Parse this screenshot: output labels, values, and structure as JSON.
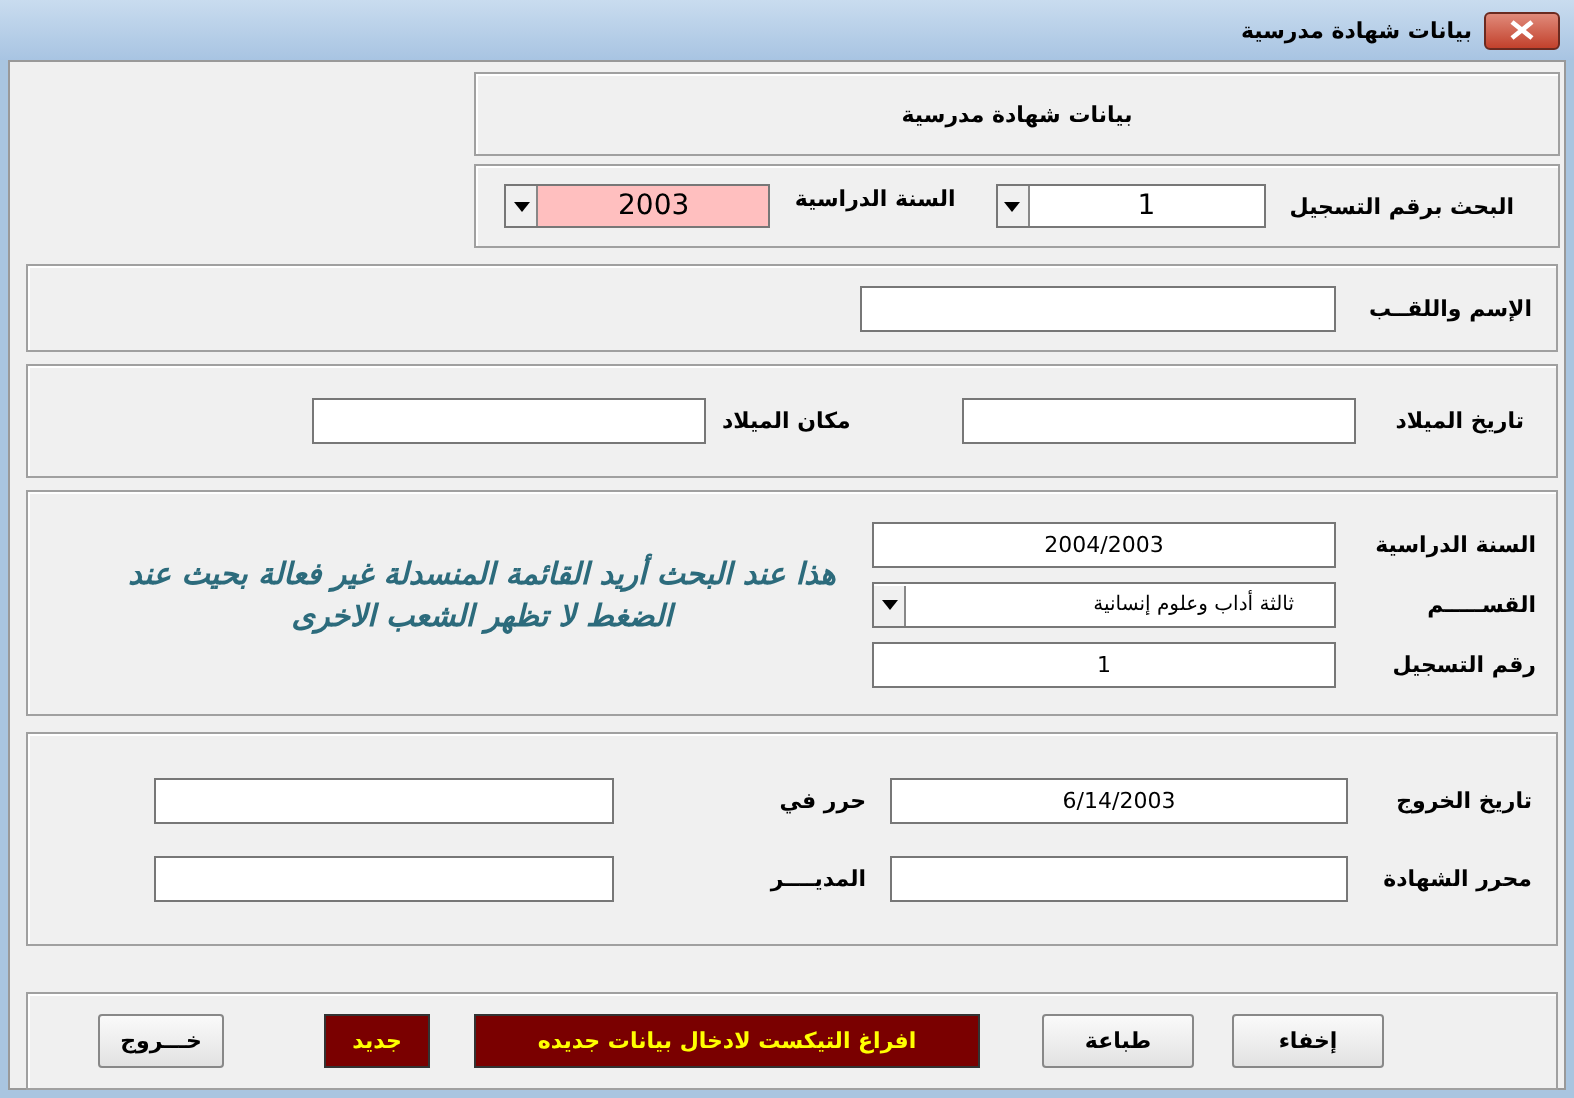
{
  "window": {
    "title": "بيانات شهادة مدرسية"
  },
  "header": {
    "title": "بيانات شهادة مدرسية"
  },
  "search": [
    {
      "label": "البحث برقم التسجيل",
      "value": "1",
      "highlighted": false
    },
    {
      "label": "السنة الدراسية",
      "value": "2003",
      "highlighted": true
    }
  ],
  "name_section": {
    "label": "الإسم واللقــب"
  },
  "birth_section": [
    {
      "label": "تاريخ الميلاد"
    },
    {
      "label": "مكان الميلاد"
    }
  ],
  "study_section": {
    "fields": [
      {
        "label": "السنة الدراسية",
        "kind": "text",
        "value": "2004/2003"
      },
      {
        "label": "القســـــم",
        "kind": "combo",
        "value": "ثالثة أداب وعلوم إنسانية"
      },
      {
        "label": "رقم التسجيل",
        "kind": "text",
        "value": "1"
      }
    ],
    "note": "هذا عند البحث أريد القائمة المنسدلة غير فعالة بحيث عند الضغط لا تظهر الشعب الاخرى"
  },
  "exit_section": [
    {
      "label": "تاريخ الخروج",
      "value": "6/14/2003"
    },
    {
      "label": "حرر في"
    },
    {
      "label": "محرر الشهادة"
    },
    {
      "label": "المديــــر"
    }
  ],
  "buttons": [
    {
      "label": "إخفاء",
      "kind": "normal"
    },
    {
      "label": "طباعة",
      "kind": "normal"
    },
    {
      "label": "افراغ التيكست لادخال بيانات جديده",
      "kind": "accent"
    },
    {
      "label": "جديد",
      "kind": "accent"
    },
    {
      "label": "خـــروج",
      "kind": "normal"
    }
  ]
}
